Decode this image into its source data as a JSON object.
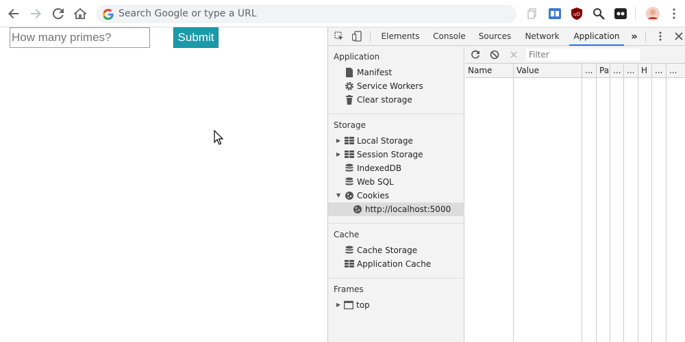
{
  "browser": {
    "omnibox_placeholder": "Search Google or type a URL"
  },
  "page": {
    "input_placeholder": "How many primes?",
    "submit_label": "Submit"
  },
  "devtools": {
    "tabs": [
      "Elements",
      "Console",
      "Sources",
      "Network",
      "Application"
    ],
    "active_tab": "Application",
    "more_tabs": "»",
    "sidebar": {
      "application": {
        "title": "Application",
        "items": [
          "Manifest",
          "Service Workers",
          "Clear storage"
        ]
      },
      "storage": {
        "title": "Storage",
        "items": [
          "Local Storage",
          "Session Storage",
          "IndexedDB",
          "Web SQL",
          "Cookies"
        ],
        "cookie_child": "http://localhost:5000"
      },
      "cache": {
        "title": "Cache",
        "items": [
          "Cache Storage",
          "Application Cache"
        ]
      },
      "frames": {
        "title": "Frames",
        "items": [
          "top"
        ]
      }
    },
    "cookies": {
      "filter_placeholder": "Filter",
      "columns": [
        "Name",
        "Value",
        "...",
        "Pa",
        "...",
        "...",
        "H",
        "...",
        "..."
      ]
    }
  }
}
